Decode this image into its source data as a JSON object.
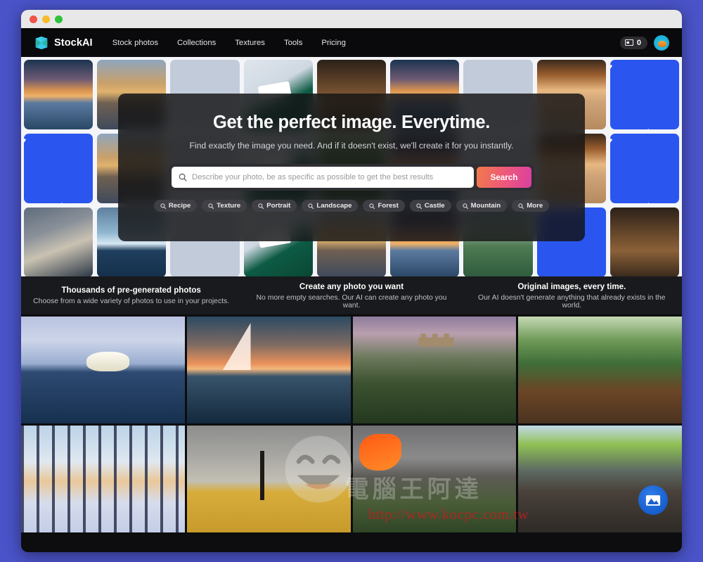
{
  "window": {
    "traffic_lights": [
      "close",
      "minimize",
      "maximize"
    ]
  },
  "nav": {
    "brand": "StockAI",
    "brand_icon": "stockai-logo-icon",
    "links": [
      {
        "label": "Stock photos"
      },
      {
        "label": "Collections"
      },
      {
        "label": "Textures"
      },
      {
        "label": "Tools"
      },
      {
        "label": "Pricing"
      }
    ],
    "credits": {
      "icon": "credit-card-icon",
      "count": "0"
    },
    "avatar": {
      "icon": "user-avatar"
    }
  },
  "hero": {
    "title": "Get the perfect image. Everytime.",
    "subtitle": "Find exactly the image you need. And if it doesn't exist, we'll create it for you instantly.",
    "search": {
      "icon": "search-icon",
      "value": "",
      "placeholder": "Describe your photo, be as specific as possible to get the best results",
      "button_label": "Search"
    },
    "chips": [
      {
        "label": "Recipe"
      },
      {
        "label": "Texture"
      },
      {
        "label": "Portrait"
      },
      {
        "label": "Landscape"
      },
      {
        "label": "Forest"
      },
      {
        "label": "Castle"
      },
      {
        "label": "Mountain"
      },
      {
        "label": "More"
      }
    ],
    "mosaic_tiles": [
      "sunset-sea",
      "whisky-glass",
      "white-curve",
      "boat-deck",
      "seashell",
      "sunset-sea",
      "white-curve",
      "palm-beach",
      "blue-curve",
      "blue-curve",
      "whisky-glass",
      "white-curve",
      "boat-deck",
      "seashell",
      "sunset-sea",
      "white-curve",
      "palm-beach",
      "blue-curve",
      "forklift-warehouse",
      "iceberg",
      "boat-deck",
      "seashell",
      "city-river",
      "blue-curve",
      "wine-barrels",
      "sunset-sea",
      "whisky-glass",
      "white-curve",
      "boat-deck",
      "seashell",
      "sunset-sea",
      "white-curve",
      "palm-beach",
      "blue-curve",
      "blue-curve",
      "whisky-glass",
      "white-curve",
      "boat-deck",
      "palm-beach"
    ]
  },
  "features": [
    {
      "title": "Thousands of pre-generated photos",
      "desc": "Choose from a wide variety of photos to use in your projects."
    },
    {
      "title": "Create any photo you want",
      "desc": "No more empty searches. Our AI can create any photo you want."
    },
    {
      "title": "Original images, every time.",
      "desc": "Our AI doesn't generate anything that already exists in the world."
    }
  ],
  "gallery": [
    {
      "name": "polar-bear-on-ice"
    },
    {
      "name": "sailboats-at-sunset"
    },
    {
      "name": "hilltop-castle"
    },
    {
      "name": "jungle-river"
    },
    {
      "name": "snowy-forest-sunrise"
    },
    {
      "name": "windmills-wheat-field"
    },
    {
      "name": "erupting-volcano"
    },
    {
      "name": "amsterdam-canal"
    }
  ],
  "watermark": {
    "url": "http://www.kocpc.com.tw",
    "cjk": "電腦王阿達",
    "smiley": "laughing-emoji-watermark",
    "badge": "site-badge-icon"
  },
  "colors": {
    "page_background": "#4a53c8",
    "nav_background": "#0a0a0c",
    "overlay_background": "#121214",
    "search_button_gradient_start": "#f07a4a",
    "search_button_gradient_end": "#db3fa0",
    "brand_accent": "#35c8e8"
  }
}
